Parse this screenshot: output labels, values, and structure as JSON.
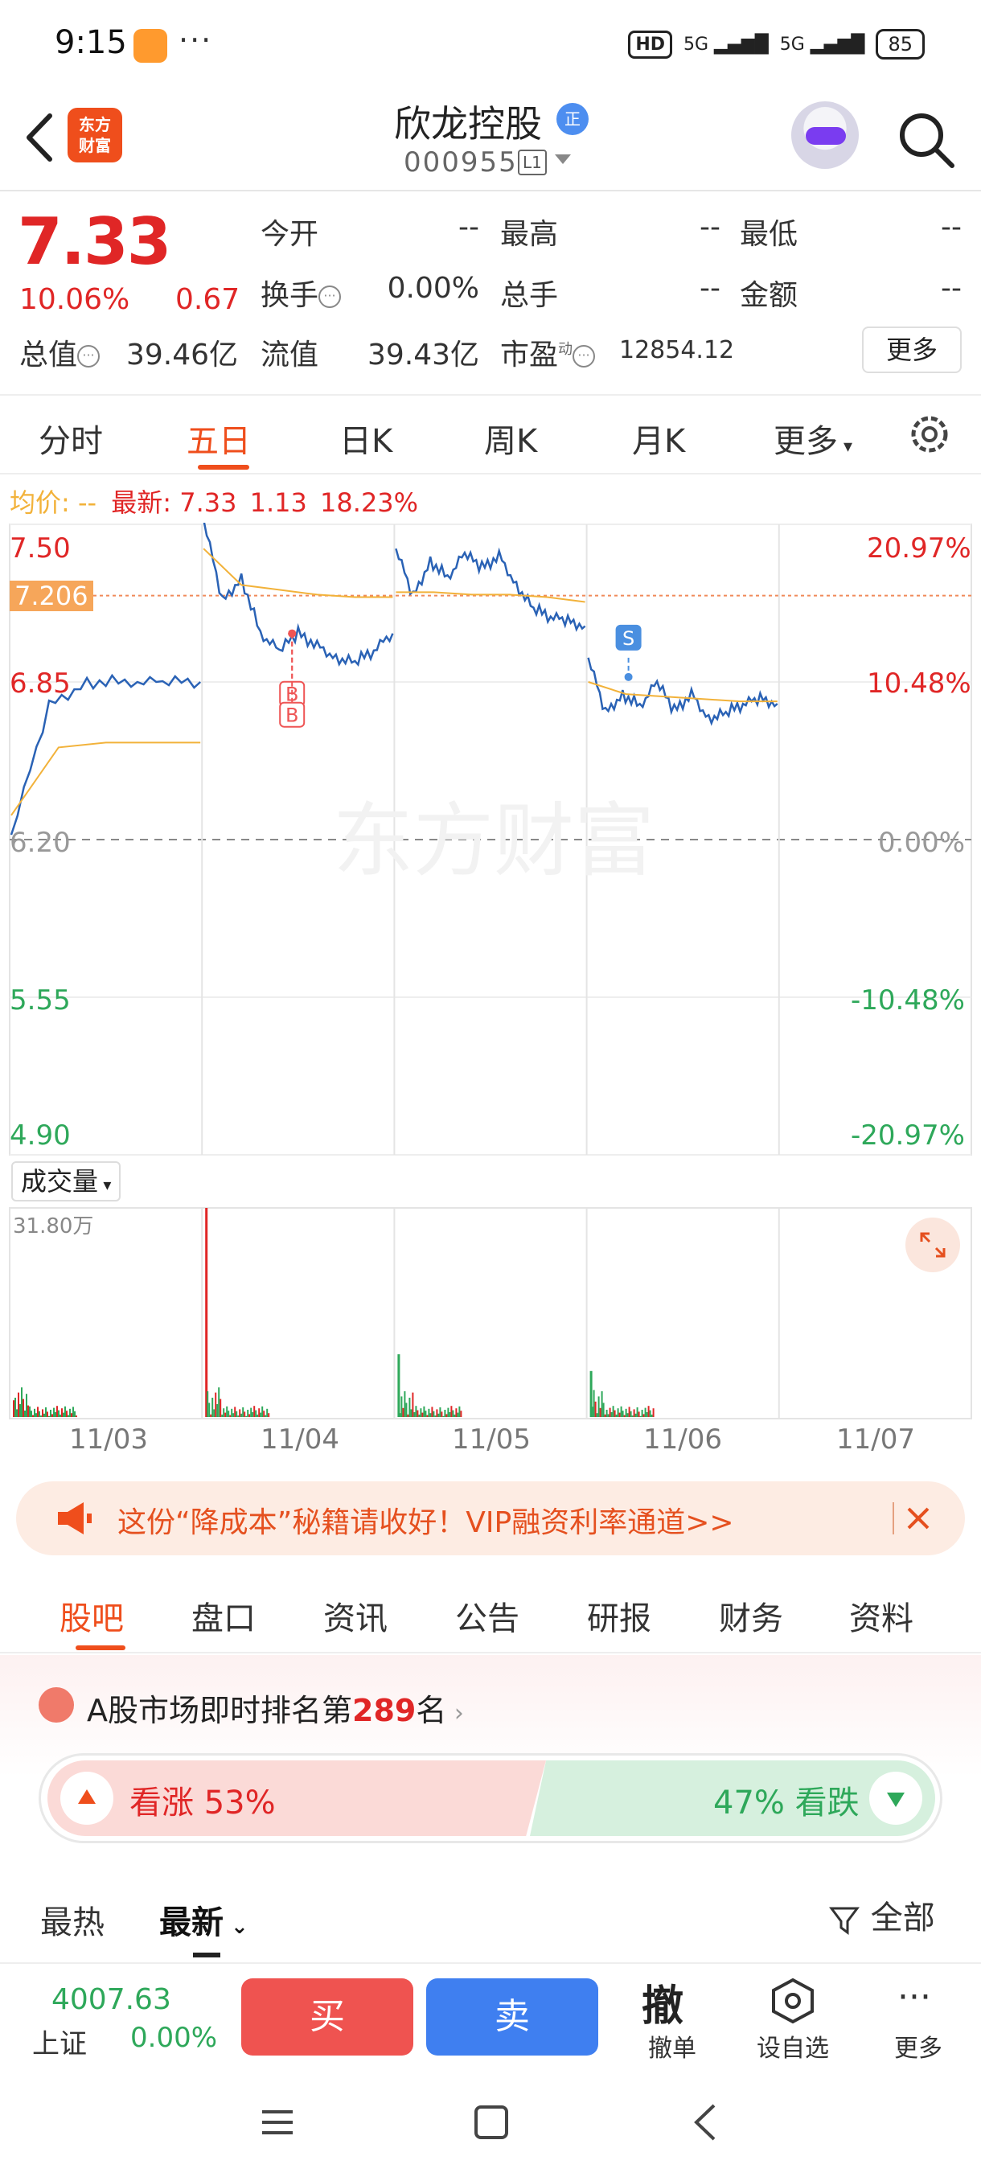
{
  "status_bar": {
    "time": "9:15",
    "dots": "···",
    "hd": "HD",
    "network1": "5G",
    "network2": "5G",
    "battery": "85"
  },
  "header": {
    "logo_text_line1": "东方",
    "logo_text_line2": "财富",
    "stock_name": "欣龙控股",
    "margin_badge": "正",
    "stock_code": "000955",
    "level_badge": "L1"
  },
  "quote": {
    "price": "7.33",
    "pct_change": "10.06%",
    "amt_change": "0.67",
    "open_label": "今开",
    "open_value": "--",
    "high_label": "最高",
    "high_value": "--",
    "low_label": "最低",
    "low_value": "--",
    "turnover_label": "换手",
    "turnover_value": "0.00%",
    "volume_label": "总手",
    "volume_value": "--",
    "amount_label": "金额",
    "amount_value": "--",
    "mktcap_label": "总值",
    "mktcap_value": "39.46亿",
    "float_label": "流值",
    "float_value": "39.43亿",
    "pe_label": "市盈",
    "pe_sup": "动",
    "pe_value": "12854.12",
    "more_button": "更多"
  },
  "chart_tabs": {
    "items": [
      "分时",
      "五日",
      "日K",
      "周K",
      "月K",
      "更多"
    ],
    "active": "五日"
  },
  "indicator": {
    "avg_label": "均价:",
    "avg_value": "--",
    "latest_label": "最新:",
    "latest_price": "7.33",
    "latest_change": "1.13",
    "latest_pct": "18.23%"
  },
  "chart_data": {
    "type": "line",
    "title": "",
    "y_left_ticks": [
      "7.50",
      "6.85",
      "6.20",
      "5.55",
      "4.90"
    ],
    "y_right_ticks": [
      "20.97%",
      "10.48%",
      "0.00%",
      "-10.48%",
      "-20.97%"
    ],
    "ylim": [
      4.9,
      7.5
    ],
    "reference_price": "6.20",
    "crosshair_price": "7.206",
    "x_dates": [
      "11/03",
      "11/04",
      "11/05",
      "11/06",
      "11/07"
    ],
    "series": [
      {
        "name": "最新",
        "color": "#2a62b5",
        "day_values": [
          [
            6.22,
            6.75,
            6.85,
            6.85,
            6.85,
            6.85
          ],
          [
            7.52,
            7.18,
            7.28,
            7.05,
            6.98,
            7.05,
            7.0,
            6.95,
            6.93,
            6.98,
            7.05
          ],
          [
            7.4,
            7.2,
            7.35,
            7.28,
            7.38,
            7.32,
            7.37,
            7.25,
            7.15,
            7.12,
            7.1,
            7.08
          ],
          [
            6.95,
            6.72,
            6.8,
            6.75,
            6.85,
            6.73,
            6.8,
            6.7,
            6.72,
            6.76,
            6.78,
            6.76
          ]
        ]
      },
      {
        "name": "均价",
        "color": "#f2b23a",
        "day_values": [
          [
            6.3,
            6.58,
            6.6,
            6.6,
            6.6
          ],
          [
            7.4,
            7.25,
            7.23,
            7.21,
            7.2,
            7.2
          ],
          [
            7.22,
            7.22,
            7.21,
            7.21,
            7.2,
            7.18
          ],
          [
            6.85,
            6.8,
            6.79,
            6.78,
            6.77,
            6.77
          ]
        ]
      }
    ],
    "markers": [
      {
        "type": "B",
        "label": "B",
        "day": 1,
        "price": 7.05
      },
      {
        "type": "B",
        "label": "B",
        "day": 1,
        "price": 7.05
      },
      {
        "type": "S",
        "label": "S",
        "day": 3,
        "price": 6.95
      }
    ],
    "volume": {
      "label": "成交量",
      "max_label": "31.80万",
      "spikes": [
        {
          "day": 0,
          "value": 0.08,
          "color": "#e02626"
        },
        {
          "day": 1,
          "value": 1.0,
          "color": "#e02626"
        },
        {
          "day": 2,
          "value": 0.3,
          "color": "#2ea85a"
        },
        {
          "day": 3,
          "value": 0.22,
          "color": "#2ea85a"
        }
      ]
    },
    "watermark": "东方财富"
  },
  "promo": {
    "text": "这份“降成本”秘籍请收好！VIP融资利率通道>>"
  },
  "section_tabs": {
    "items": [
      "股吧",
      "盘口",
      "资讯",
      "公告",
      "研报",
      "财务",
      "资料"
    ],
    "active": "股吧"
  },
  "ranking": {
    "prefix": "A股市场即时排名第",
    "rank": "289",
    "suffix": "名",
    "bull_label": "看涨 53%",
    "bear_label": "47% 看跌",
    "bull_pct": 53,
    "bear_pct": 47
  },
  "feed_tabs": {
    "hot": "最热",
    "latest": "最新",
    "filter": "全部"
  },
  "trade_bar": {
    "index_value": "4007.63",
    "index_name": "上证",
    "index_pct": "0.00%",
    "buy": "买",
    "sell": "卖",
    "cancel_big": "撤",
    "cancel_label": "撤单",
    "watch_label": "设自选",
    "more_label": "更多"
  }
}
